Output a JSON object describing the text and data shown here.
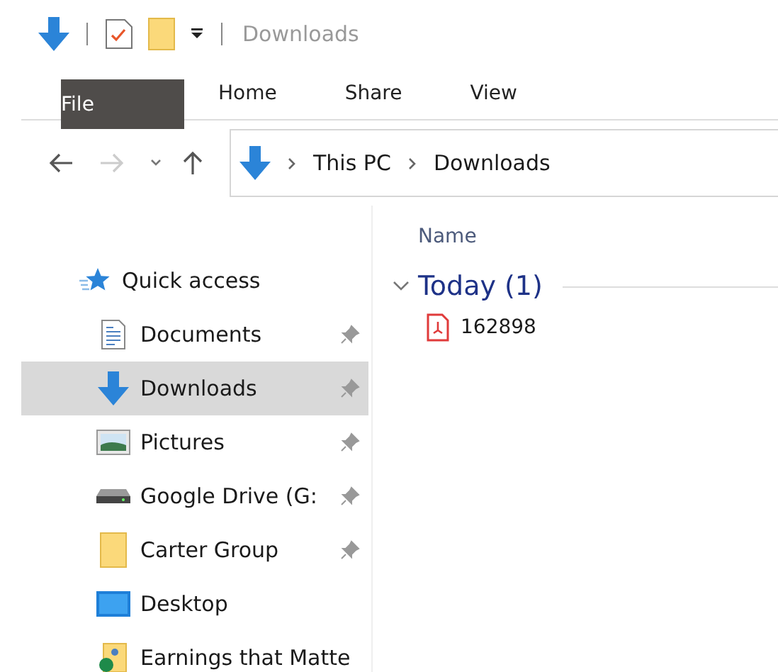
{
  "window": {
    "title": "Downloads"
  },
  "ribbon": {
    "tabs": [
      {
        "label": "File",
        "kind": "file",
        "selected": false
      },
      {
        "label": "Home",
        "kind": "tab",
        "selected": false
      },
      {
        "label": "Share",
        "kind": "tab",
        "selected": false
      },
      {
        "label": "View",
        "kind": "tab",
        "selected": false
      }
    ]
  },
  "navigation": {
    "forward_disabled": true
  },
  "address_bar": {
    "path": [
      "This PC",
      "Downloads"
    ]
  },
  "sidebar": {
    "header": "Quick access",
    "items": [
      {
        "label": "Documents",
        "kind": "document",
        "pinned": true,
        "selected": false
      },
      {
        "label": "Downloads",
        "kind": "download",
        "pinned": true,
        "selected": true
      },
      {
        "label": "Pictures",
        "kind": "pictures",
        "pinned": true,
        "selected": false
      },
      {
        "label": "Google Drive (G:",
        "kind": "drive",
        "pinned": true,
        "selected": false
      },
      {
        "label": "Carter Group",
        "kind": "folder",
        "pinned": true,
        "selected": false
      },
      {
        "label": "Desktop",
        "kind": "desktop",
        "pinned": false,
        "selected": false
      },
      {
        "label": "Earnings that Matte",
        "kind": "shared",
        "pinned": false,
        "selected": false
      }
    ]
  },
  "file_list": {
    "column": "Name",
    "groups": [
      {
        "label": "Today (1)",
        "expanded": true,
        "files": [
          {
            "name": "162898",
            "kind": "pdf"
          }
        ]
      }
    ]
  }
}
